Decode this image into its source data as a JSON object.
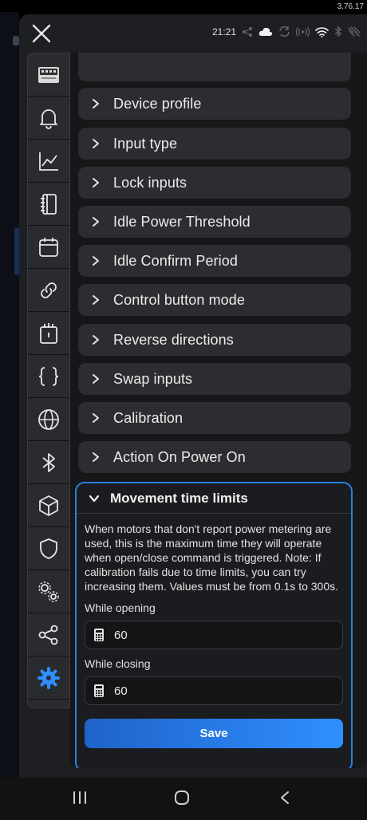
{
  "version": "3.76.17",
  "status": {
    "time": "21:21"
  },
  "sections": [
    "Device profile",
    "Input type",
    "Lock inputs",
    "Idle Power Threshold",
    "Idle Confirm Period",
    "Control button mode",
    "Reverse directions",
    "Swap inputs",
    "Calibration",
    "Action On Power On"
  ],
  "expanded": {
    "title": "Movement time limits",
    "description": "When motors that don't report power metering are used, this is the maximum time they will operate when open/close command is triggered. Note: If calibration fails due to time limits, you can try increasing them. Values must be from 0.1s to 300s.",
    "opening_label": "While opening",
    "opening_value": "60",
    "closing_label": "While closing",
    "closing_value": "60",
    "save_label": "Save"
  },
  "colors": {
    "accent": "#2f8fff",
    "panel": "#1e1f22",
    "card": "#2c2d30"
  },
  "nav_icons": [
    "device-thumbnail-icon",
    "bell-icon",
    "chart-icon",
    "schedule-icon",
    "calendar-icon",
    "link-icon",
    "timer-icon",
    "script-braces-icon",
    "globe-icon",
    "bluetooth-icon",
    "cube-icon",
    "shield-icon",
    "gears-icon",
    "share-icon",
    "settings-gear-icon"
  ]
}
